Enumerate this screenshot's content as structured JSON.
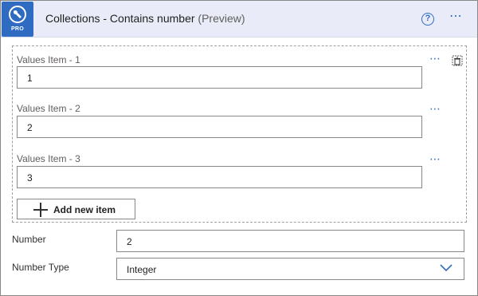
{
  "header": {
    "badge_text": "PRO",
    "title_main": "Collections - Contains number ",
    "title_suffix": "(Preview)",
    "help_glyph": "?",
    "more_glyph": "⋯"
  },
  "values": {
    "items": [
      {
        "label": "Values Item - 1",
        "value": "1"
      },
      {
        "label": "Values Item - 2",
        "value": "2"
      },
      {
        "label": "Values Item - 3",
        "value": "3"
      }
    ],
    "more_glyph": "⋯",
    "add_label": "Add new item"
  },
  "number": {
    "label": "Number",
    "value": "2"
  },
  "number_type": {
    "label": "Number Type",
    "value": "Integer"
  },
  "icons": {
    "app": "wrench-icon",
    "help": "help-circle-icon",
    "more": "more-options-icon",
    "delete": "delete-icon",
    "add": "plus-icon",
    "dropdown": "chevron-down-icon"
  },
  "colors": {
    "accent": "#2f6cc1",
    "header_bg": "#e9ecf8",
    "border": "#8a8886"
  }
}
